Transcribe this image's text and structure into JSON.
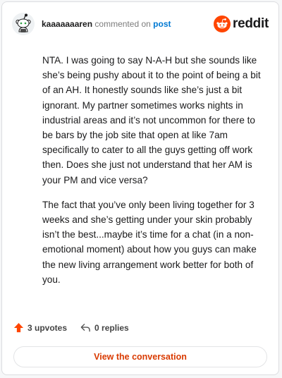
{
  "header": {
    "username": "kaaaaaaaren",
    "action_text": "commented on",
    "post_link": "post",
    "brand_name": "reddit"
  },
  "comment": {
    "paragraphs": [
      "NTA. I was going to say N-A-H but she sounds like she’s being pushy about it to the point of being a bit of an AH. It honestly sounds like she’s just a bit ignorant. My partner sometimes works nights in industrial areas and it’s not uncommon for there to be bars by the job site that open at like 7am specifically to cater to all the guys getting off work then. Does she just not understand that her AM is your PM and vice versa?",
      "The fact that you’ve only been living together for 3 weeks and she’s getting under your skin probably isn’t the best...maybe it’s time for a chat (in a non-emotional moment) about how you guys can make the new living arrangement work better for both of you."
    ]
  },
  "actions": {
    "upvotes": "3 upvotes",
    "replies": "0 replies"
  },
  "cta": {
    "label": "View the conversation"
  },
  "icons": {
    "avatar": "snoo-avatar-icon",
    "brand": "reddit-logo-icon",
    "upvote": "upvote-arrow-icon",
    "reply": "reply-arrow-icon"
  },
  "colors": {
    "brand_orange": "#ff4500",
    "link_blue": "#0079d3",
    "cta_text": "#d93a00",
    "upvote": "#ff4500"
  }
}
